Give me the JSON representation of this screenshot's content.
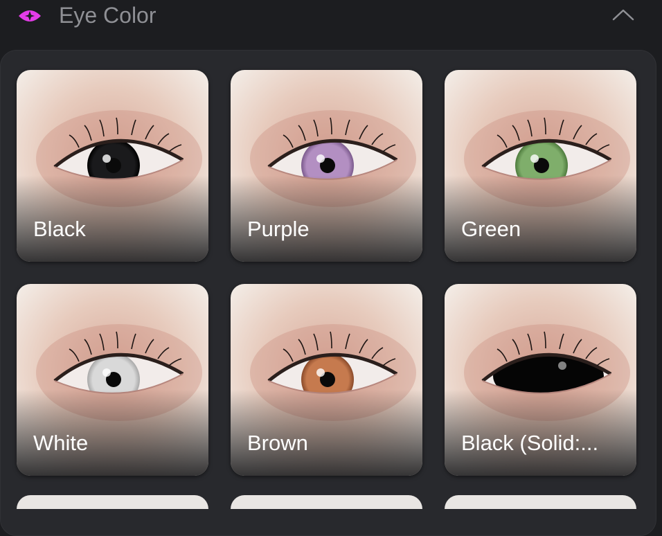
{
  "section": {
    "title": "Eye Color",
    "icon": "eye-icon",
    "accent_color": "#e43ce8",
    "collapse_icon": "chevron-up-icon"
  },
  "options": [
    {
      "label": "Black",
      "iris_color": "#1a1a1c",
      "iris_ring": "#000000"
    },
    {
      "label": "Purple",
      "iris_color": "#b38fc2",
      "iris_ring": "#7b5a8c"
    },
    {
      "label": "Green",
      "iris_color": "#7fae6b",
      "iris_ring": "#4d7a3c"
    },
    {
      "label": "White",
      "iris_color": "#d9d9d9",
      "iris_ring": "#a8a8a8"
    },
    {
      "label": "Brown",
      "iris_color": "#c67a4e",
      "iris_ring": "#8a4a2a"
    },
    {
      "label": "Black (Solid:...",
      "iris_color": "#050505",
      "iris_ring": "#000000"
    }
  ]
}
